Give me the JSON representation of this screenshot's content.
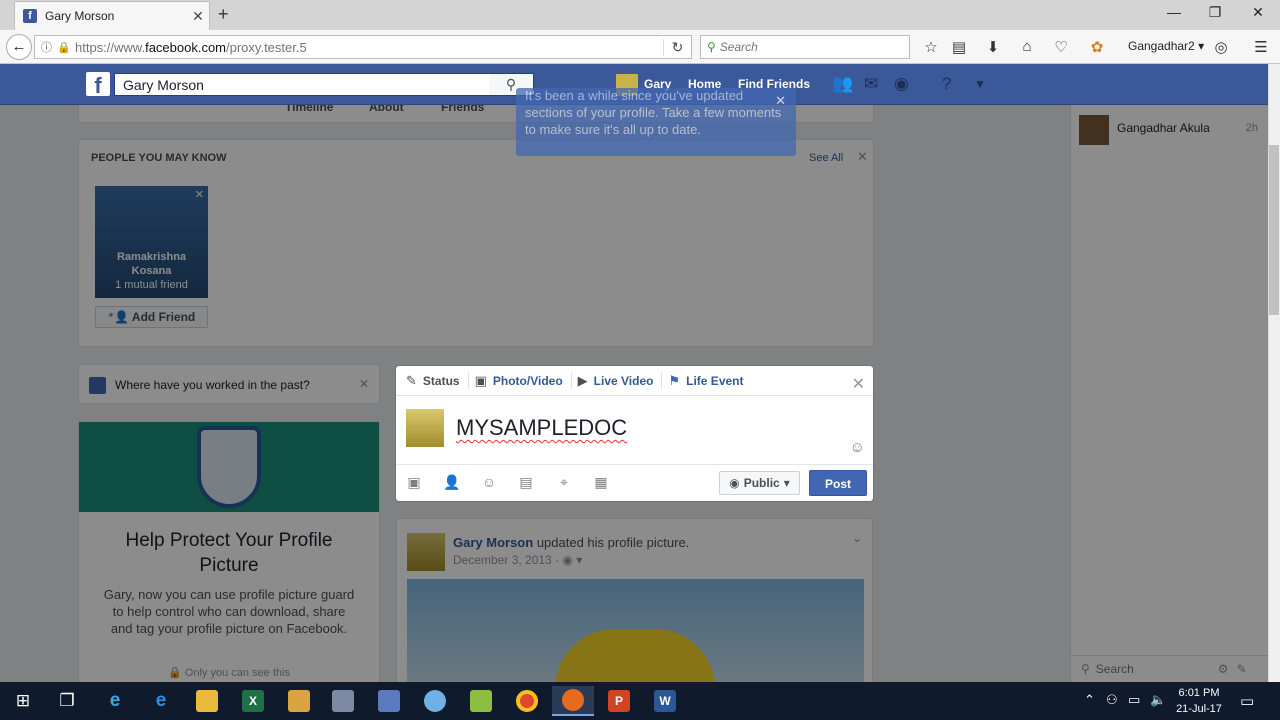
{
  "browser": {
    "tab_title": "Gary Morson",
    "url_prefix": "https://www.",
    "url_domain": "facebook.com",
    "url_path": "/proxy.tester.5",
    "search_placeholder": "Search",
    "profile_name": "Gangadhar2"
  },
  "facebook": {
    "search_value": "Gary Morson",
    "nav_user": "Gary",
    "nav_home": "Home",
    "nav_find_friends": "Find Friends"
  },
  "profile_nav": {
    "timeline": "Timeline",
    "about": "About",
    "friends": "Friends"
  },
  "tooltip": {
    "text": "It's been a while since you've updated sections of your profile. Take a few moments to make sure it's all up to date."
  },
  "pymk": {
    "header": "PEOPLE YOU MAY KNOW",
    "see_all": "See All",
    "person_name_line1": "Ramakrishna",
    "person_name_line2": "Kosana",
    "mutual": "1 mutual friend",
    "add_friend": "Add Friend"
  },
  "work_prompt": {
    "text": "Where have you worked in the past?"
  },
  "guard": {
    "title": "Help Protect Your Profile Picture",
    "body": "Gary, now you can use profile picture guard to help control who can download, share and tag your profile picture on Facebook.",
    "visibility": "Only you can see this"
  },
  "composer": {
    "tab_status": "Status",
    "tab_photo": "Photo/Video",
    "tab_live": "Live Video",
    "tab_life": "Life Event",
    "text": "MYSAMPLEDOC",
    "audience": "Public",
    "post": "Post"
  },
  "feed_post": {
    "author": "Gary Morson",
    "action": "updated his profile picture.",
    "date": "December 3, 2013"
  },
  "chat": {
    "contact_name": "Gangadhar Akula",
    "contact_time": "2h",
    "search_placeholder": "Search"
  },
  "taskbar": {
    "time": "6:01 PM",
    "date": "21-Jul-17"
  },
  "colors": {
    "fb_blue": "#3b5998",
    "post_button": "#4267b2",
    "link": "#365899"
  }
}
